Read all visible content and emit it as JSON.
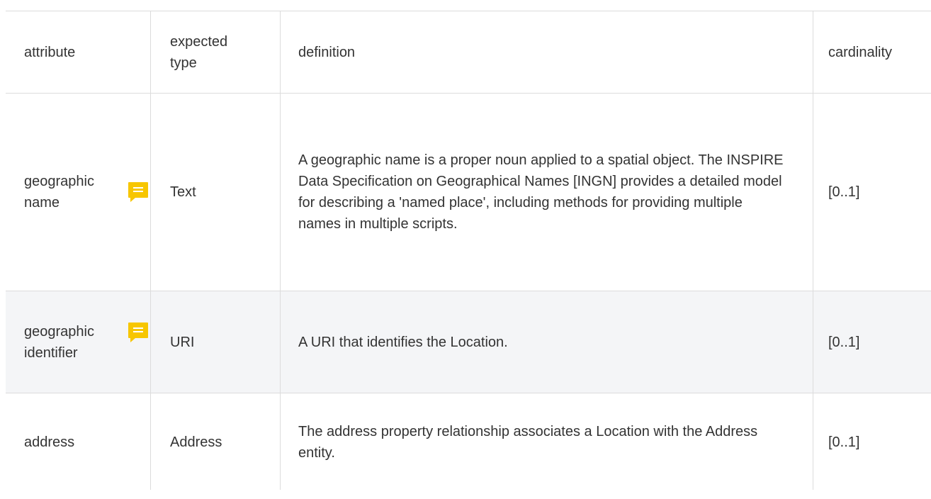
{
  "table": {
    "headers": {
      "attribute": "attribute",
      "expected_type_line1": "expected",
      "expected_type_line2": "type",
      "definition": "definition",
      "cardinality": "cardinality"
    },
    "rows": [
      {
        "attribute_line1": "geographic",
        "attribute_line2": "name",
        "has_comment": true,
        "expected_type": "Text",
        "definition": "A geographic name is a proper noun applied to a spatial object. The INSPIRE Data Specification on Geographical Names [INGN] provides a detailed model for describing a 'named place', including methods for providing multiple names in multiple scripts.",
        "cardinality": "[0..1]"
      },
      {
        "attribute_line1": "geographic",
        "attribute_line2": "identifier",
        "has_comment": true,
        "expected_type": "URI",
        "definition": "A URI that identifies the Location.",
        "cardinality": "[0..1]"
      },
      {
        "attribute": "address",
        "expected_type": "Address",
        "definition": "The address property relationship associates a Location with the Address entity.",
        "cardinality": "[0..1]"
      }
    ]
  },
  "icons": {
    "comment": "comment-icon"
  },
  "colors": {
    "comment_icon": "#f7c600",
    "highlight_row": "#f4f5f7",
    "border": "#dcdcdc",
    "text": "#333333"
  }
}
